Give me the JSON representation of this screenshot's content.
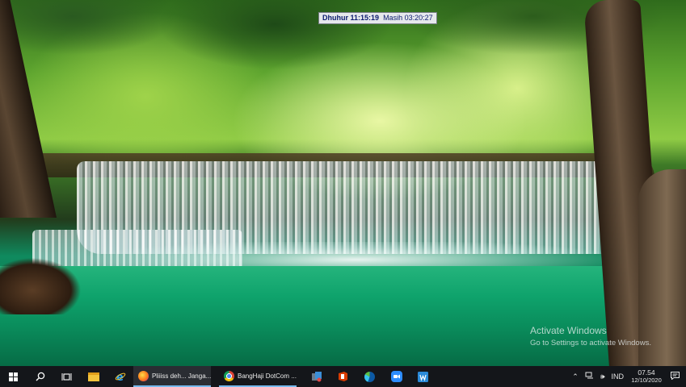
{
  "prayer_widget": {
    "name": "Dhuhur",
    "time": "11:15:19",
    "remaining_label": "Masih",
    "remaining": "03:20:27"
  },
  "watermark": {
    "title": "Activate Windows",
    "subtitle": "Go to Settings to activate Windows."
  },
  "taskbar": {
    "apps": [
      {
        "icon": "firefox-icon",
        "label": "Pliiiss deh... Janga..."
      },
      {
        "icon": "chrome-icon",
        "label": "BangHaji DotCom ..."
      }
    ],
    "pinned_icons": [
      "start-icon",
      "search-icon",
      "task-view-icon",
      "file-explorer-icon",
      "internet-explorer-icon",
      "firefox-icon",
      "chrome-icon",
      "app-icon",
      "office-icon",
      "edge-icon",
      "zoom-icon",
      "word-icon"
    ],
    "tray": {
      "language": "IND",
      "time": "07.54",
      "date": "12/10/2020"
    }
  },
  "colors": {
    "taskbar": "#14161a",
    "accent_underline": "#76b9ed",
    "widget_text": "#0a1a6e"
  }
}
